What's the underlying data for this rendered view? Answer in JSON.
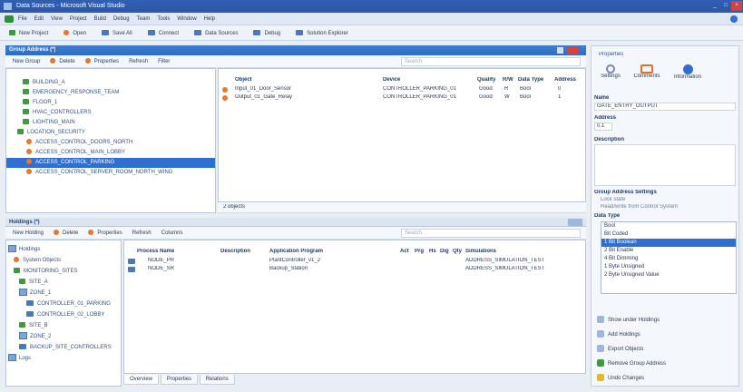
{
  "window": {
    "title": "Data Sources - Microsoft Visual Studio",
    "controls": [
      "_",
      "□",
      "×"
    ]
  },
  "menu": {
    "items": [
      "File",
      "Edit",
      "View",
      "Project",
      "Build",
      "Debug",
      "Team",
      "Tools",
      "Window",
      "Help"
    ]
  },
  "toolbar": {
    "items": [
      "New Project",
      "Open",
      "Save All",
      "Connect",
      "Data Sources",
      "Debug",
      "Solution Explorer"
    ]
  },
  "groups_panel": {
    "title": "Group Address (*)",
    "buttons": [
      "New Group",
      "Delete",
      "Properties",
      "Refresh",
      "Filter"
    ],
    "search_placeholder": "Search",
    "tree": [
      {
        "label": "BUILDING_A",
        "icon": "green",
        "selected": false
      },
      {
        "label": "EMERGENCY_RESPONSE_TEAM",
        "icon": "green",
        "selected": false
      },
      {
        "label": "FLOOR_1",
        "icon": "green",
        "selected": false
      },
      {
        "label": "HVAC_CONTROLLERS",
        "icon": "green",
        "selected": false
      },
      {
        "label": "LIGHTING_MAIN",
        "icon": "green",
        "selected": false
      },
      {
        "label": "LOCATION_SECURITY",
        "icon": "green",
        "selected": false
      },
      {
        "label": "ACCESS_CONTROL_DOORS_NORTH",
        "icon": "orange",
        "selected": false
      },
      {
        "label": "ACCESS_CONTROL_MAIN_LOBBY",
        "icon": "orange",
        "selected": false
      },
      {
        "label": "ACCESS_CONTROL_PARKING",
        "icon": "orange",
        "selected": true
      },
      {
        "label": "ACCESS_CONTROL_SERVER_ROOM_NORTH_WING",
        "icon": "orange",
        "selected": false
      }
    ],
    "list_headers": [
      "Object",
      "Device",
      "Quality",
      "R/W",
      "Data Type",
      "Address"
    ],
    "rows": [
      {
        "object": "Input_01_Door_Sensor",
        "device": "CONTROLLER_PARKING_01",
        "quality": "Good",
        "rw": "R",
        "type": "Bool",
        "addr": "0"
      },
      {
        "object": "Output_01_Gate_Relay",
        "device": "CONTROLLER_PARKING_01",
        "quality": "Good",
        "rw": "W",
        "type": "Bool",
        "addr": "1"
      }
    ],
    "status": "2 objects"
  },
  "holdings_panel": {
    "title": "Holdings (*)",
    "buttons": [
      "New Holding",
      "Delete",
      "Properties",
      "Refresh",
      "Columns"
    ],
    "search_placeholder": "Search",
    "tree": [
      {
        "label": "Holdings",
        "indent": 0
      },
      {
        "label": "System Objects",
        "indent": 1
      },
      {
        "label": "MONITORING_SITES",
        "indent": 1
      },
      {
        "label": "SITE_A",
        "indent": 2
      },
      {
        "label": "ZONE_1",
        "indent": 2
      },
      {
        "label": "CONTROLLER_01_PARKING",
        "indent": 3
      },
      {
        "label": "CONTROLLER_02_LOBBY",
        "indent": 3
      },
      {
        "label": "SITE_B",
        "indent": 2
      },
      {
        "label": "ZONE_2",
        "indent": 2
      },
      {
        "label": "BACKUP_SITE_CONTROLLERS",
        "indent": 2
      },
      {
        "label": "Logs",
        "indent": 0
      }
    ],
    "headers": [
      "Process Name",
      "Description",
      "Application Program",
      "Act",
      "Prg",
      "Hs",
      "Dig",
      "Qty",
      "Simulations"
    ],
    "rows": [
      {
        "name": "NODE_PR",
        "desc": "",
        "app": "PlantController_v1_2",
        "sim": "ADDRESS_SIMULATION_TEST"
      },
      {
        "name": "NODE_SR",
        "desc": "",
        "app": "Backup_Station",
        "sim": "ADDRESS_SIMULATION_TEST"
      }
    ],
    "tabs": [
      "Overview",
      "Properties",
      "Relations"
    ]
  },
  "properties_panel": {
    "title": "Properties",
    "tabs": [
      "Settings",
      "Comments",
      "Information"
    ],
    "name_label": "Name",
    "name_value": "GATE_ENTRY_OUTPUT",
    "address_label": "Address",
    "address_value": "0.1",
    "description_label": "Description",
    "sync_label": "Group Address Settings",
    "sync_items": [
      "Lock state",
      "Read/write from Control System"
    ],
    "datatype_label": "Data Type",
    "datatype_options": [
      "Bool",
      "Bit Coded",
      "1 Bit Boolean",
      "2 Bit Enable",
      "4 Bit Dimming",
      "1 Byte Unsigned",
      "2 Byte Unsigned Value"
    ],
    "datatype_selected": "1 Bit Boolean",
    "actions": [
      "Show under Holdings",
      "Add Holdings",
      "Export Objects",
      "Remove Group Address",
      "Undo Changes"
    ]
  }
}
